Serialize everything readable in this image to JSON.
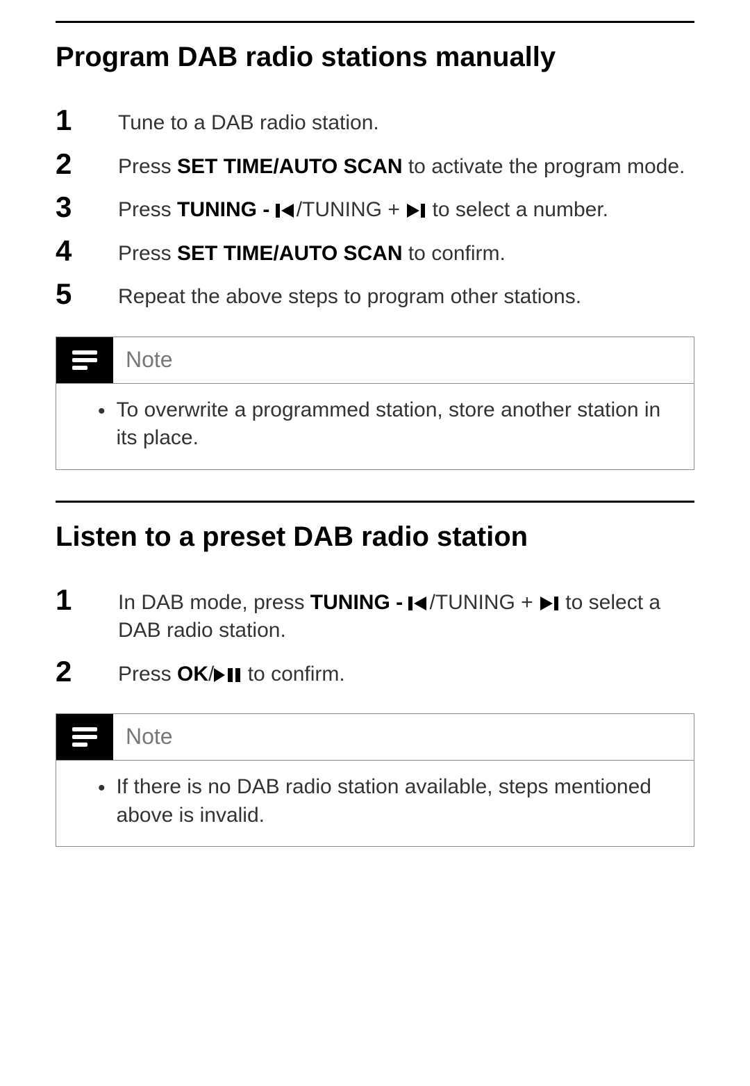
{
  "section1": {
    "title": "Program DAB radio stations manually",
    "steps": [
      {
        "parts": [
          {
            "t": "text",
            "v": "Tune to a DAB radio station."
          }
        ]
      },
      {
        "parts": [
          {
            "t": "text",
            "v": "Press "
          },
          {
            "t": "bold",
            "v": "SET TIME/AUTO SCAN"
          },
          {
            "t": "text",
            "v": " to activate the program mode."
          }
        ]
      },
      {
        "parts": [
          {
            "t": "text",
            "v": "Press "
          },
          {
            "t": "bold",
            "v": "TUNING - "
          },
          {
            "t": "icon",
            "v": "prev"
          },
          {
            "t": "text",
            "v": "/TUNING + "
          },
          {
            "t": "icon",
            "v": "next"
          },
          {
            "t": "text",
            "v": " to select a number."
          }
        ]
      },
      {
        "parts": [
          {
            "t": "text",
            "v": "Press "
          },
          {
            "t": "bold",
            "v": "SET TIME/AUTO SCAN"
          },
          {
            "t": "text",
            "v": " to confirm."
          }
        ]
      },
      {
        "parts": [
          {
            "t": "text",
            "v": "Repeat the above steps to program other stations."
          }
        ]
      }
    ],
    "note": {
      "label": "Note",
      "text": "To overwrite a programmed station, store another station in its place."
    }
  },
  "section2": {
    "title": "Listen to a preset DAB radio station",
    "steps": [
      {
        "parts": [
          {
            "t": "text",
            "v": "In DAB mode, press "
          },
          {
            "t": "bold",
            "v": "TUNING - "
          },
          {
            "t": "icon",
            "v": "prev"
          },
          {
            "t": "text",
            "v": "/TUNING + "
          },
          {
            "t": "icon",
            "v": "next"
          },
          {
            "t": "text",
            "v": " to select a DAB radio station."
          }
        ]
      },
      {
        "parts": [
          {
            "t": "text",
            "v": "Press "
          },
          {
            "t": "bold",
            "v": "OK"
          },
          {
            "t": "text",
            "v": "/"
          },
          {
            "t": "icon",
            "v": "playpause"
          },
          {
            "t": "text",
            "v": " to confirm."
          }
        ]
      }
    ],
    "note": {
      "label": "Note",
      "text": "If there is no DAB radio station available, steps mentioned above is invalid."
    }
  }
}
